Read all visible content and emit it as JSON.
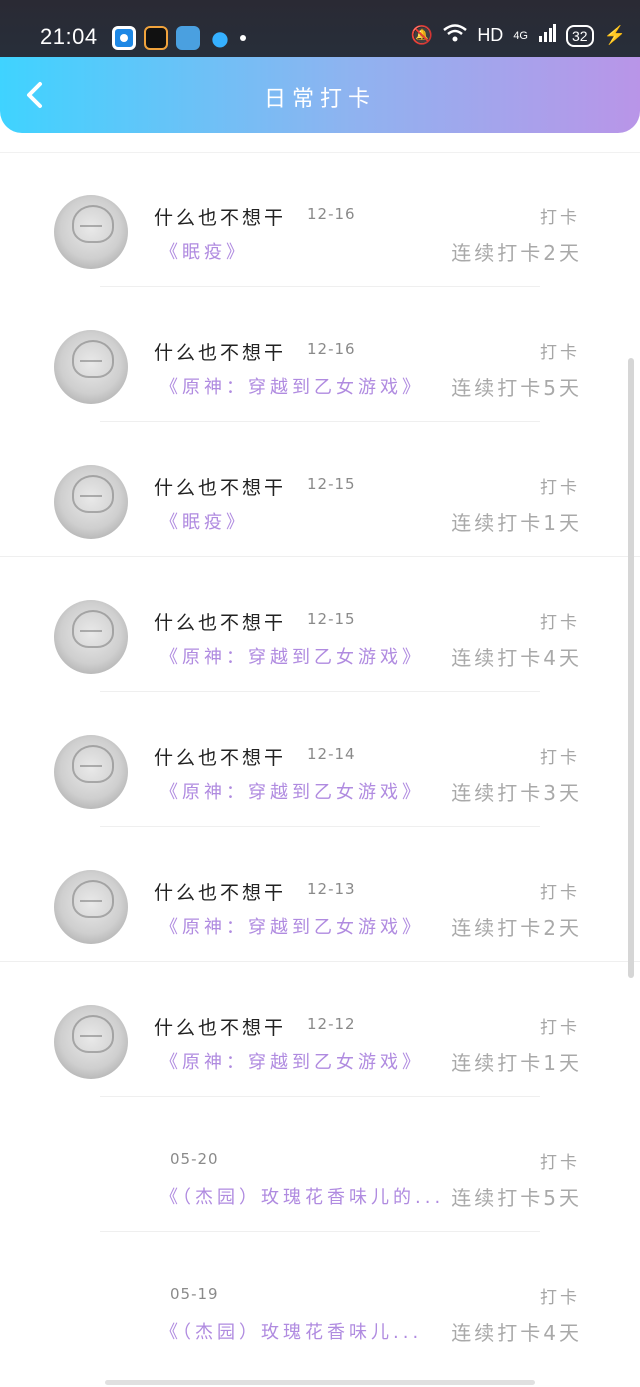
{
  "status": {
    "time": "21:04",
    "network": "HD",
    "signal": "4G",
    "battery": "32"
  },
  "header": {
    "title": "日常打卡"
  },
  "items": [
    {
      "user": "什么也不想干",
      "date": "12-16",
      "book": "《眠疫》",
      "action": "打卡",
      "streak": "连续打卡2天"
    },
    {
      "user": "什么也不想干",
      "date": "12-16",
      "book": "《原神：穿越到乙女游戏》",
      "action": "打卡",
      "streak": "连续打卡5天"
    },
    {
      "user": "什么也不想干",
      "date": "12-15",
      "book": "《眠疫》",
      "action": "打卡",
      "streak": "连续打卡1天"
    },
    {
      "user": "什么也不想干",
      "date": "12-15",
      "book": "《原神：穿越到乙女游戏》",
      "action": "打卡",
      "streak": "连续打卡4天"
    },
    {
      "user": "什么也不想干",
      "date": "12-14",
      "book": "《原神：穿越到乙女游戏》",
      "action": "打卡",
      "streak": "连续打卡3天"
    },
    {
      "user": "什么也不想干",
      "date": "12-13",
      "book": "《原神：穿越到乙女游戏》",
      "action": "打卡",
      "streak": "连续打卡2天"
    },
    {
      "user": "什么也不想干",
      "date": "12-12",
      "book": "《原神：穿越到乙女游戏》",
      "action": "打卡",
      "streak": "连续打卡1天"
    },
    {
      "date": "05-20",
      "book": "《（杰园）玫瑰花香味儿的...",
      "action": "打卡",
      "streak": "连续打卡5天"
    },
    {
      "date": "05-19",
      "book": "《（杰园）玫瑰花香味儿...",
      "action": "打卡",
      "streak": "连续打卡4天"
    }
  ]
}
